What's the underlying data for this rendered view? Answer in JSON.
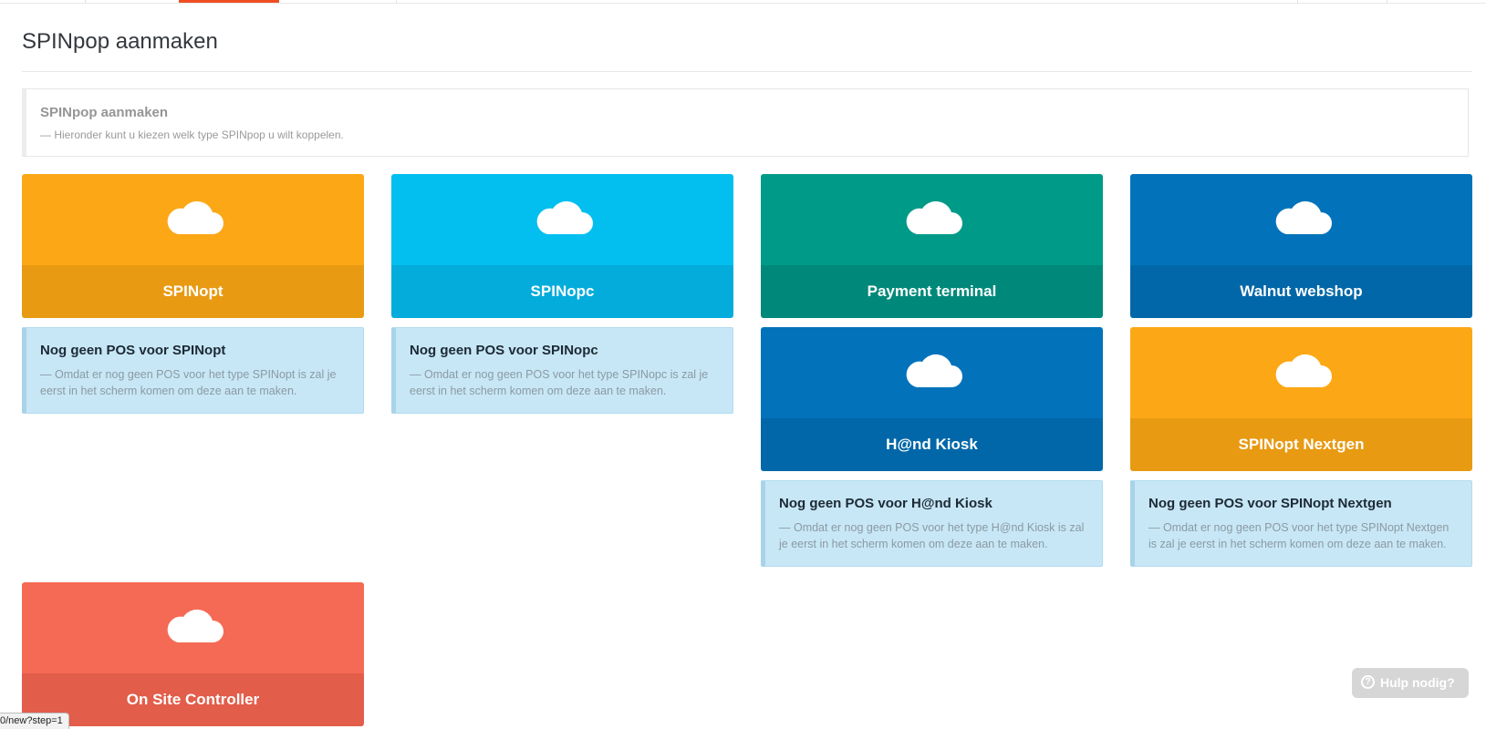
{
  "page": {
    "title": "SPINpop aanmaken"
  },
  "intro": {
    "title": "SPINpop aanmaken",
    "text": "—  Hieronder kunt u kiezen welk type SPINpop u wilt koppelen."
  },
  "tiles": [
    {
      "label": "SPINopt",
      "top_color": "#fca715",
      "bottom_color": "#e89a12",
      "icon": "cloud-icon"
    },
    {
      "label": "SPINopc",
      "top_color": "#03bfef",
      "bottom_color": "#04acdb",
      "icon": "cloud-icon"
    },
    {
      "label": "Payment terminal",
      "top_color": "#009a88",
      "bottom_color": "#00897a",
      "icon": "cloud-icon"
    },
    {
      "label": "Walnut webshop",
      "top_color": "#0273ba",
      "bottom_color": "#0267a8",
      "icon": "cloud-icon"
    },
    {
      "label": "H@nd Kiosk",
      "top_color": "#0273ba",
      "bottom_color": "#0267a8",
      "icon": "cloud-icon"
    },
    {
      "label": "SPINopt Nextgen",
      "top_color": "#fca715",
      "bottom_color": "#e89a12",
      "icon": "cloud-icon"
    },
    {
      "label": "On Site Controller",
      "top_color": "#f56a54",
      "bottom_color": "#e25d4a",
      "icon": "cloud-icon"
    }
  ],
  "notices": [
    {
      "title": "Nog geen POS voor SPINopt",
      "text": "—  Omdat er nog geen POS voor het type SPINopt is zal je eerst in het scherm komen om deze aan te maken."
    },
    {
      "title": "Nog geen POS voor SPINopc",
      "text": "—  Omdat er nog geen POS voor het type SPINopc is zal je eerst in het scherm komen om deze aan te maken."
    },
    {
      "title": "Nog geen POS voor H@nd Kiosk",
      "text": "—  Omdat er nog geen POS voor het type H@nd Kiosk is zal je eerst in het scherm komen om deze aan te maken."
    },
    {
      "title": "Nog geen POS voor SPINopt Nextgen",
      "text": "—  Omdat er nog geen POS voor het type SPINopt Nextgen is zal je eerst in het scherm komen om deze aan te maken."
    }
  ],
  "help": {
    "label": "Hulp nodig?",
    "icon": "question-icon"
  },
  "status_bar": {
    "url": "0/new?step=1"
  }
}
